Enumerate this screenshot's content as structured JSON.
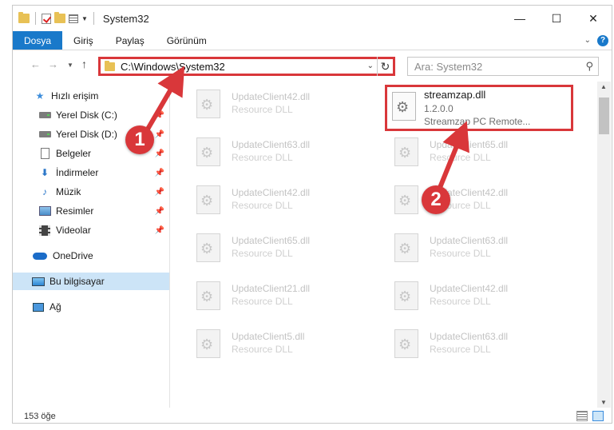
{
  "window": {
    "title": "System32",
    "minimize_glyph": "—",
    "maximize_glyph": "☐",
    "close_glyph": "✕"
  },
  "ribbon": {
    "tabs": [
      "Dosya",
      "Giriş",
      "Paylaş",
      "Görünüm"
    ],
    "expand_glyph": "⌄",
    "help_glyph": "?"
  },
  "address": {
    "path": "C:\\Windows\\System32",
    "search_placeholder": "Ara: System32"
  },
  "nav": {
    "quick_access": "Hızlı erişim",
    "items": [
      {
        "label": "Yerel Disk (C:)",
        "icon": "drive-icon"
      },
      {
        "label": "Yerel Disk (D:)",
        "icon": "drive-icon"
      },
      {
        "label": "Belgeler",
        "icon": "documents-icon"
      },
      {
        "label": "İndirmeler",
        "icon": "downloads-icon"
      },
      {
        "label": "Müzik",
        "icon": "music-icon"
      },
      {
        "label": "Resimler",
        "icon": "pictures-icon"
      },
      {
        "label": "Videolar",
        "icon": "videos-icon"
      }
    ],
    "onedrive": "OneDrive",
    "this_pc": "Bu bilgisayar",
    "network": "Ağ"
  },
  "files": {
    "highlighted": {
      "name": "streamzap.dll",
      "version": "1.2.0.0",
      "description": "Streamzap PC Remote..."
    },
    "left_column": [
      {
        "name": "UpdateClient42.dll",
        "desc": "Resource DLL"
      },
      {
        "name": "UpdateClient63.dll",
        "desc": "Resource DLL"
      },
      {
        "name": "UpdateClient42.dll",
        "desc": "Resource DLL"
      },
      {
        "name": "UpdateClient65.dll",
        "desc": "Resource DLL"
      },
      {
        "name": "UpdateClient21.dll",
        "desc": "Resource DLL"
      },
      {
        "name": "UpdateClient5.dll",
        "desc": "Resource DLL"
      }
    ],
    "right_column": [
      {
        "name": "UpdateClient65.dll",
        "desc": "Resource DLL"
      },
      {
        "name": "UpdateClient42.dll",
        "desc": "Resource DLL"
      },
      {
        "name": "UpdateClient63.dll",
        "desc": "Resource DLL"
      },
      {
        "name": "UpdateClient42.dll",
        "desc": "Resource DLL"
      },
      {
        "name": "UpdateClient63.dll",
        "desc": "Resource DLL"
      }
    ]
  },
  "status": {
    "count": "153 öğe"
  },
  "annotations": {
    "badge1": "1",
    "badge2": "2",
    "color": "#d9373a"
  }
}
